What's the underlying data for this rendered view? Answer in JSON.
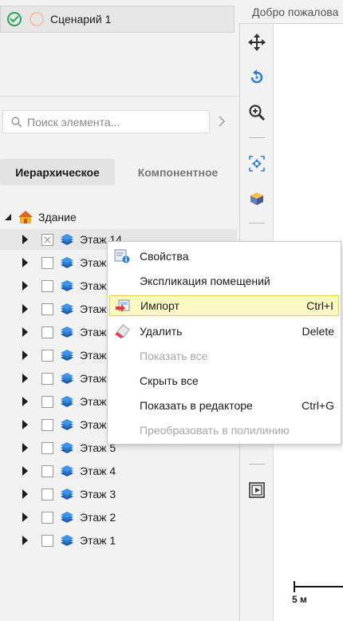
{
  "scenario": {
    "label": "Сценарий 1"
  },
  "document_tab": {
    "label": "Добро пожалова"
  },
  "search": {
    "placeholder": "Поиск элемента..."
  },
  "view_tabs": {
    "hierarchical": "Иерархическое",
    "component": "Компонентное"
  },
  "tree": {
    "root": "Здание",
    "floors": [
      "Этаж 14",
      "Этаж",
      "Этаж",
      "Этаж",
      "Этаж",
      "Этаж",
      "Этаж",
      "Этаж",
      "Этаж",
      "Этаж 5",
      "Этаж 4",
      "Этаж 3",
      "Этаж 2",
      "Этаж 1"
    ]
  },
  "context_menu": {
    "items": [
      {
        "label": "Свойства",
        "shortcut": "",
        "icon": "properties-icon",
        "disabled": false,
        "highlighted": false
      },
      {
        "label": "Экспликация помещений",
        "shortcut": "",
        "icon": "",
        "disabled": false,
        "highlighted": false
      },
      {
        "label": "Импорт",
        "shortcut": "Ctrl+I",
        "icon": "import-icon",
        "disabled": false,
        "highlighted": true
      },
      {
        "label": "Удалить",
        "shortcut": "Delete",
        "icon": "eraser-icon",
        "disabled": false,
        "highlighted": false
      },
      {
        "label": "Показать все",
        "shortcut": "",
        "icon": "",
        "disabled": true,
        "highlighted": false
      },
      {
        "label": "Скрыть все",
        "shortcut": "",
        "icon": "",
        "disabled": false,
        "highlighted": false
      },
      {
        "label": "Показать в редакторе",
        "shortcut": "Ctrl+G",
        "icon": "",
        "disabled": false,
        "highlighted": false
      },
      {
        "label": "Преобразовать в полилинию",
        "shortcut": "",
        "icon": "",
        "disabled": true,
        "highlighted": false
      }
    ]
  },
  "scale_bar": {
    "label": "5 м"
  },
  "colors": {
    "accent_blue": "#2f7fd6",
    "highlight": "#fdf8c4",
    "check_green": "#29a35a"
  }
}
